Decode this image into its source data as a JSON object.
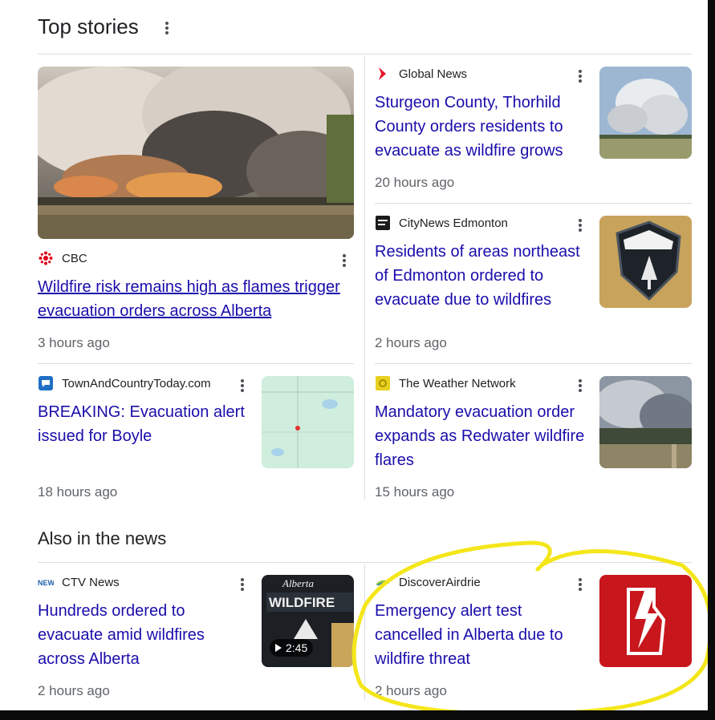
{
  "top_stories": {
    "title": "Top stories",
    "stories": [
      {
        "source": "CBC",
        "headline": "Wildfire risk remains high as flames trigger evacuation orders across Alberta",
        "time": "3 hours ago",
        "favicon": "cbc-gem-icon",
        "thumb": "wildfire-smoke-photo"
      },
      {
        "source": "Global News",
        "headline": "Sturgeon County, Thorhild County orders residents to evacuate as wildfire grows",
        "time": "20 hours ago",
        "favicon": "global-news-chevron-icon",
        "thumb": "smoke-plume-photo"
      },
      {
        "source": "CityNews Edmonton",
        "headline": "Residents of areas northeast of Edmonton ordered to evacuate due to wildfires",
        "time": "2 hours ago",
        "favicon": "citynews-icon",
        "thumb": "wildfire-patch-photo"
      },
      {
        "source": "TownAndCountryToday.com",
        "headline": "BREAKING: Evacuation alert issued for Boyle",
        "time": "18 hours ago",
        "favicon": "speech-bubble-icon",
        "thumb": "map-thumbnail"
      },
      {
        "source": "The Weather Network",
        "headline": "Mandatory evacuation order expands as Redwater wildfire flares",
        "time": "15 hours ago",
        "favicon": "weather-network-icon",
        "thumb": "forest-smoke-photo"
      }
    ]
  },
  "also_in_news": {
    "title": "Also in the news",
    "stories": [
      {
        "source": "CTV News",
        "headline": "Hundreds ordered to evacuate amid wildfires across Alberta",
        "time": "2 hours ago",
        "favicon": "ctv-news-icon",
        "thumb": "wildfire-patch-video",
        "video_duration": "2:45"
      },
      {
        "source": "DiscoverAirdrie",
        "headline": "Emergency alert test cancelled in Alberta due to wildfire threat",
        "time": "2 hours ago",
        "favicon": "discover-airdrie-icon",
        "thumb": "alberta-alert-logo"
      }
    ]
  },
  "thumbnails": {
    "patch_top_text": "Alberta",
    "patch_main_text": "WILDFIRE"
  },
  "colors": {
    "headline_link": "#1a0dab",
    "annotation_highlight": "#f4e61a",
    "alert_red": "#c8161d"
  }
}
